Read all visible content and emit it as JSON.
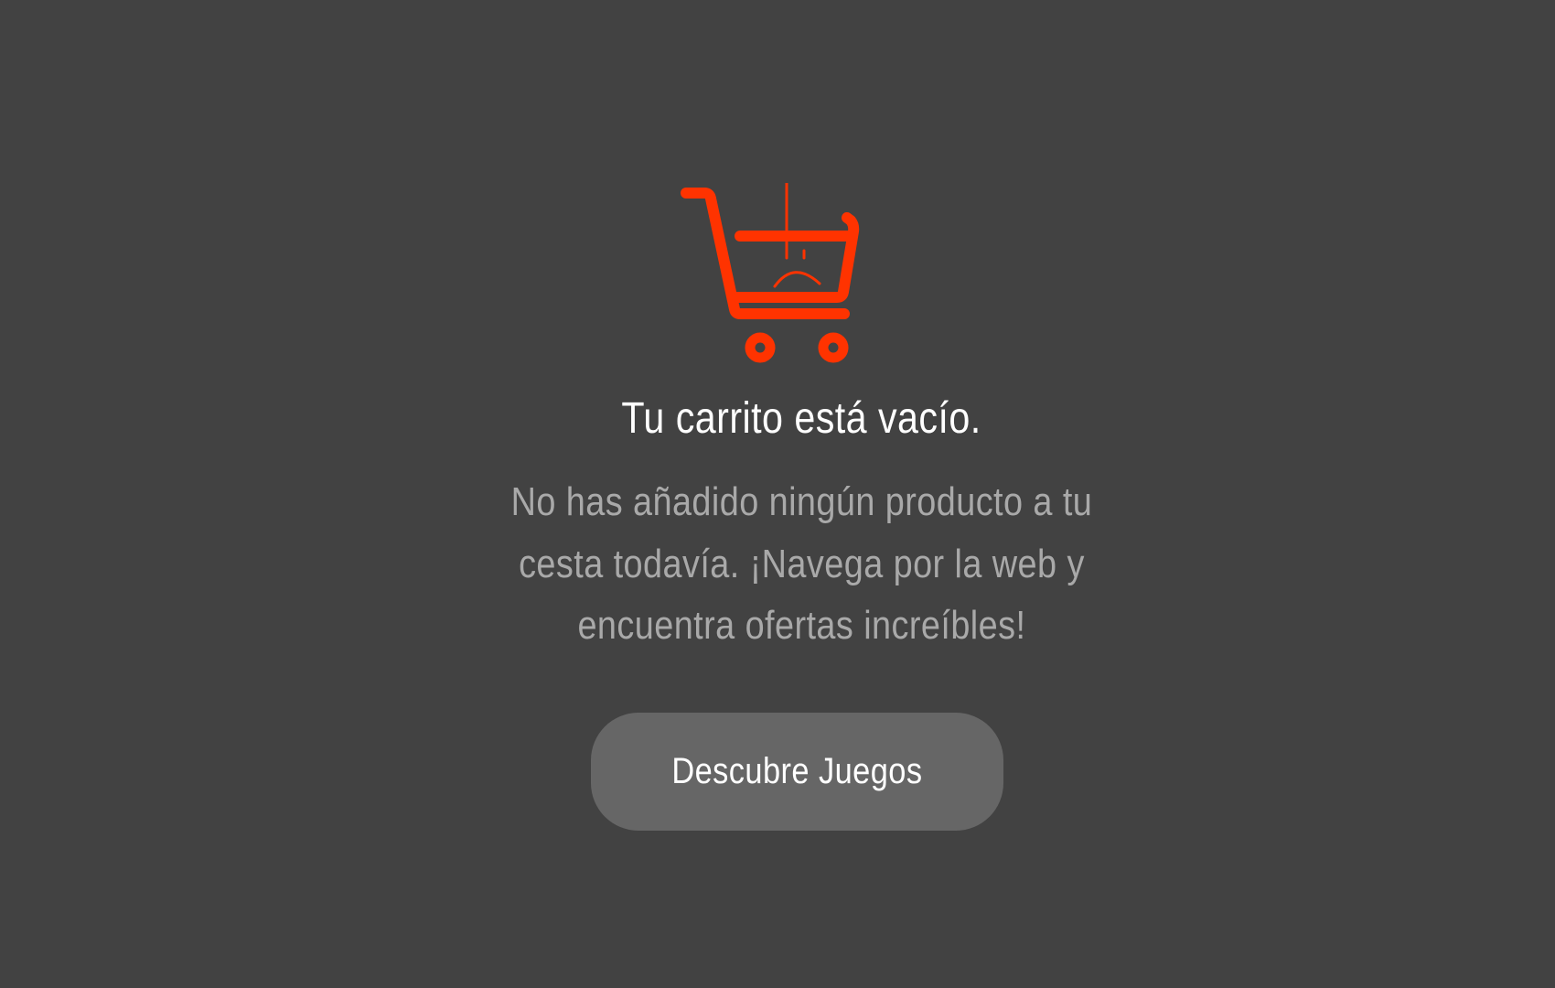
{
  "empty_cart": {
    "icon": "sad-shopping-cart-icon",
    "accent_color": "#ff3300",
    "title": "Tu carrito está vacío.",
    "message": "No has añadido ningún producto a tu cesta todavía. ¡Navega por la web y encuentra ofertas increíbles!",
    "button_label": "Descubre Juegos"
  },
  "colors": {
    "background": "#424242",
    "title": "#ffffff",
    "message": "#a9a9a9",
    "button_background": "#666666",
    "button_text": "#ffffff"
  }
}
